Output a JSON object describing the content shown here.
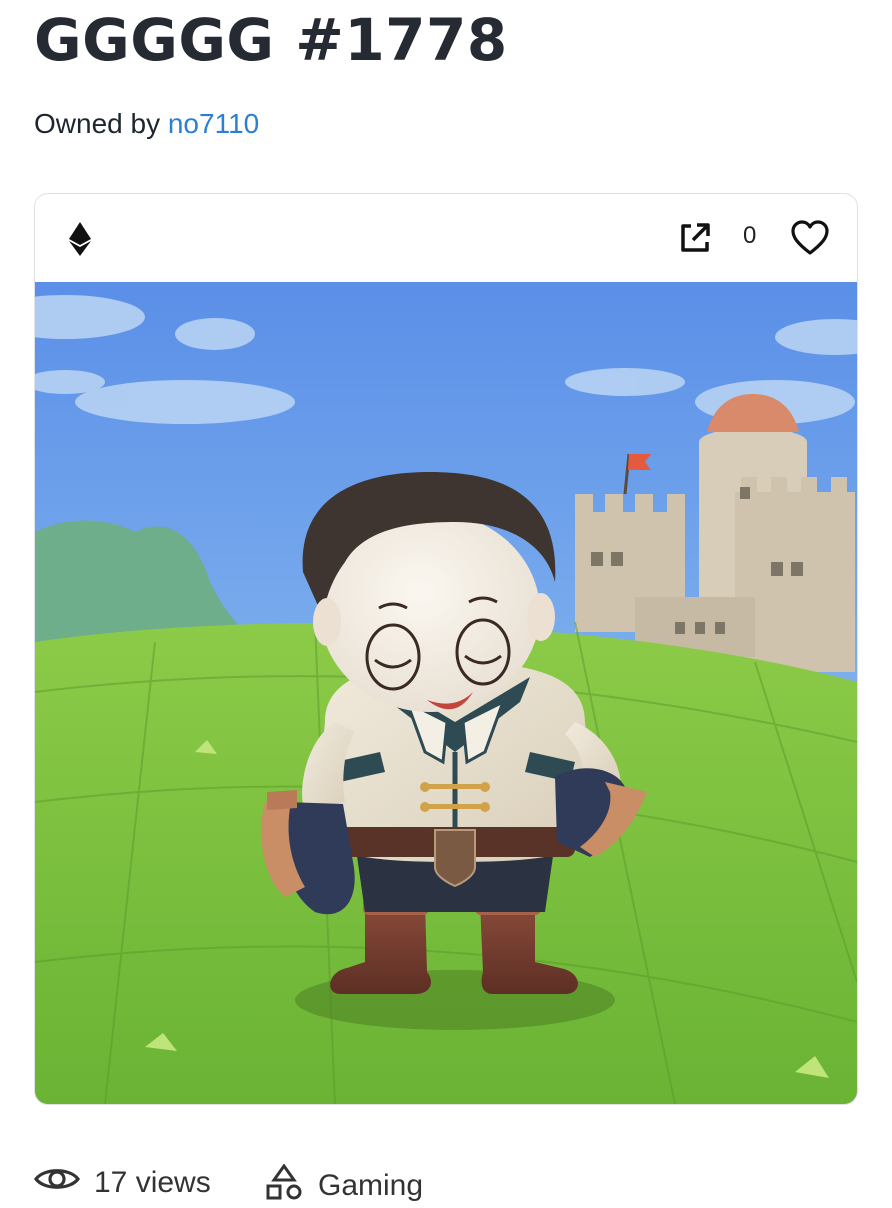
{
  "title": "GGGGG #1778",
  "owner": {
    "prefix": "Owned by",
    "name": "no7110"
  },
  "card": {
    "chain_icon": "ethereum-icon",
    "favorites_count": "0",
    "open_icon": "open-external-icon",
    "favorite_icon": "heart-icon"
  },
  "stats": {
    "views": "17 views",
    "category": "Gaming",
    "views_icon": "eye-icon",
    "category_icon": "shapes-icon"
  },
  "colors": {
    "link": "#2b7fd4",
    "title": "#262a33"
  }
}
